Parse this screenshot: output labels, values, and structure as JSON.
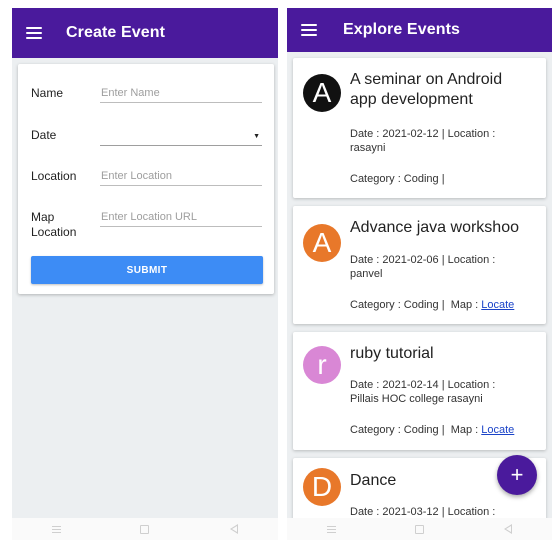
{
  "create_screen": {
    "title": "Create Event",
    "fields": {
      "name": {
        "label": "Name",
        "value": "",
        "placeholder": "Enter Name"
      },
      "date": {
        "label": "Date",
        "value": ""
      },
      "location": {
        "label": "Location",
        "value": "",
        "placeholder": "Enter Location"
      },
      "map_location": {
        "label_line1": "Map",
        "label_line2": "Location",
        "value": "",
        "placeholder": "Enter Location URL"
      }
    },
    "submit_label": "SUBMIT"
  },
  "explore_screen": {
    "title": "Explore Events",
    "events": [
      {
        "initial": "A",
        "avatar_color": "#111111",
        "title_line1": "A seminar on Android",
        "title_line2": "app development",
        "meta_line1": "Date : 2021-02-12  |  Location :",
        "meta_line2": "rasayni",
        "category": "Category : Coding  |",
        "map_prefix": "",
        "map_link": ""
      },
      {
        "initial": "A",
        "avatar_color": "#e8782a",
        "title_line1": "Advance java workshoo",
        "title_line2": "",
        "meta_line1": "Date : 2021-02-06  |  Location :",
        "meta_line2": "panvel",
        "category": "Category : Coding  |",
        "map_prefix": "  Map : ",
        "map_link": "Locate"
      },
      {
        "initial": "r",
        "avatar_color": "#d987d5",
        "title_line1": "ruby tutorial",
        "title_line2": "",
        "meta_line1": "Date : 2021-02-14  |  Location :",
        "meta_line2": "Pillais HOC college rasayni",
        "category": "Category : Coding  |",
        "map_prefix": "  Map : ",
        "map_link": "Locate"
      },
      {
        "initial": "D",
        "avatar_color": "#e8782a",
        "title_line1": "Dance",
        "title_line2": "",
        "meta_line1": "Date : 2021-03-12  |  Location :",
        "meta_line2": "",
        "category": "",
        "map_prefix": "",
        "map_link": ""
      }
    ],
    "fab_label": "+"
  },
  "theme": {
    "primary": "#4a1a9c",
    "button": "#3d8cf5",
    "link": "#1a43c8"
  },
  "icons": {
    "menu": "hamburger-menu-icon",
    "nav": [
      "recents-icon",
      "home-icon",
      "back-icon"
    ]
  }
}
